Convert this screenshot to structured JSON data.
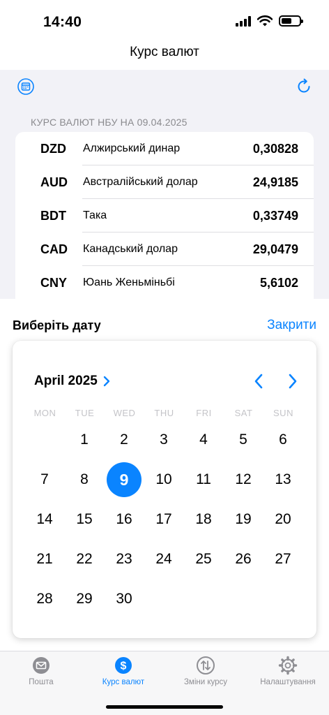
{
  "status": {
    "time": "14:40"
  },
  "nav": {
    "title": "Курс валют"
  },
  "rates": {
    "header": "КУРС ВАЛЮТ НБУ НА 09.04.2025",
    "items": [
      {
        "code": "DZD",
        "name": "Алжирський динар",
        "value": "0,30828"
      },
      {
        "code": "AUD",
        "name": "Австралійський долар",
        "value": "24,9185"
      },
      {
        "code": "BDT",
        "name": "Така",
        "value": "0,33749"
      },
      {
        "code": "CAD",
        "name": "Канадський долар",
        "value": "29,0479"
      },
      {
        "code": "CNY",
        "name": "Юань Женьміньбі",
        "value": "5,6102"
      }
    ]
  },
  "date_sheet": {
    "title": "Виберіть дату",
    "close_label": "Закрити",
    "month_label": "April 2025",
    "weekdays": [
      "MON",
      "TUE",
      "WED",
      "THU",
      "FRI",
      "SAT",
      "SUN"
    ],
    "days": [
      "1",
      "2",
      "3",
      "4",
      "5",
      "6",
      "7",
      "8",
      "9",
      "10",
      "11",
      "12",
      "13",
      "14",
      "15",
      "16",
      "17",
      "18",
      "19",
      "20",
      "21",
      "22",
      "23",
      "24",
      "25",
      "26",
      "27",
      "28",
      "29",
      "30"
    ],
    "selected_day": "9"
  },
  "tabs": [
    {
      "label": "Пошта",
      "icon": "mail-icon",
      "active": false
    },
    {
      "label": "Курс валют",
      "icon": "dollar-icon",
      "active": true
    },
    {
      "label": "Зміни курсу",
      "icon": "arrows-updown-icon",
      "active": false
    },
    {
      "label": "Налаштування",
      "icon": "gear-icon",
      "active": false
    }
  ],
  "colors": {
    "accent": "#0a84ff",
    "background": "#f2f2f7",
    "secondary_text": "#8e8e93"
  }
}
